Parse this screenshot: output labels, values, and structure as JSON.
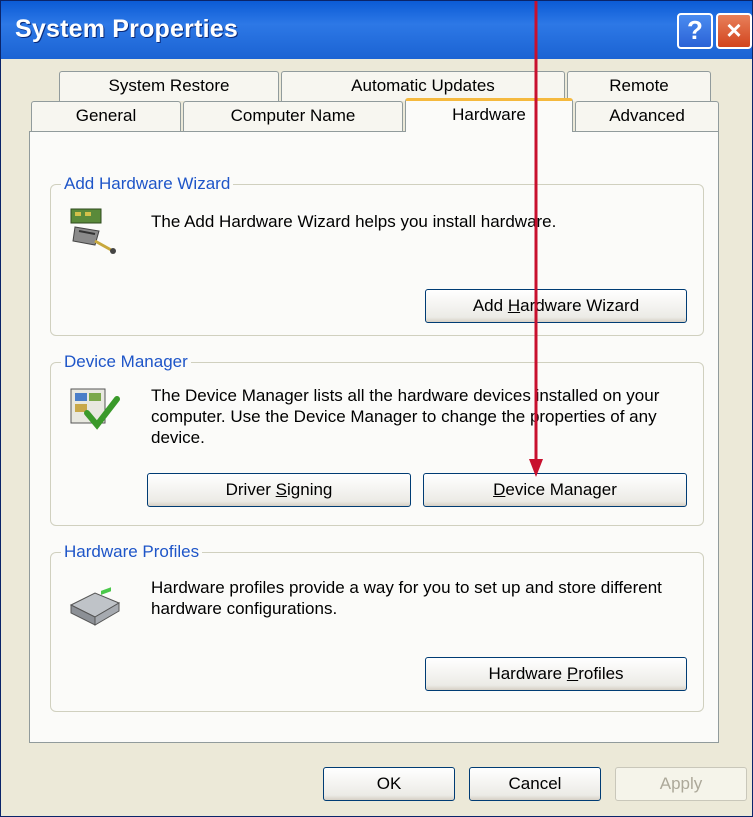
{
  "window": {
    "title": "System Properties",
    "help_label": "?",
    "close_label": "×"
  },
  "tabs": {
    "row_back": [
      "System Restore",
      "Automatic Updates",
      "Remote"
    ],
    "row_front": [
      "General",
      "Computer Name",
      "Hardware",
      "Advanced"
    ],
    "active": "Hardware"
  },
  "add_hardware": {
    "group_title": "Add Hardware Wizard",
    "description": "The Add Hardware Wizard helps you install hardware.",
    "button_pre": "Add ",
    "button_accel": "H",
    "button_post": "ardware Wizard"
  },
  "device_manager": {
    "group_title": "Device Manager",
    "description": "The Device Manager lists all the hardware devices installed on your computer. Use the Device Manager to change the properties of any device.",
    "driver_pre": "Driver ",
    "driver_accel": "S",
    "driver_post": "igning",
    "dm_accel": "D",
    "dm_post": "evice Manager"
  },
  "hardware_profiles": {
    "group_title": "Hardware Profiles",
    "description": "Hardware profiles provide a way for you to set up and store different hardware configurations.",
    "button_pre": "Hardware ",
    "button_accel": "P",
    "button_post": "rofiles"
  },
  "footer": {
    "ok": "OK",
    "cancel": "Cancel",
    "apply": "Apply"
  },
  "colors": {
    "titlebar": "#2d78e6",
    "annotation_arrow": "#c8102e",
    "group_title": "#1e55c8"
  }
}
